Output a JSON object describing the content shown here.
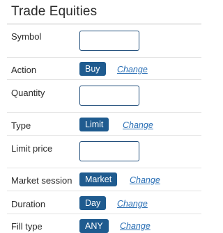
{
  "title": "Trade Equities",
  "fields": {
    "symbol": {
      "label": "Symbol",
      "value": ""
    },
    "action": {
      "label": "Action",
      "value": "Buy",
      "change": "Change"
    },
    "quantity": {
      "label": "Quantity",
      "value": ""
    },
    "type": {
      "label": "Type",
      "value": "Limit",
      "change": "Change"
    },
    "limit_price": {
      "label": "Limit price",
      "value": ""
    },
    "market_session": {
      "label": "Market session",
      "value": "Market",
      "change": "Change"
    },
    "duration": {
      "label": "Duration",
      "value": "Day",
      "change": "Change"
    },
    "fill_type": {
      "label": "Fill type",
      "value": "ANY",
      "change": "Change"
    }
  },
  "colors": {
    "pill_bg": "#1f5b8f",
    "link": "#2a6fb5",
    "input_border": "#214e7b"
  }
}
